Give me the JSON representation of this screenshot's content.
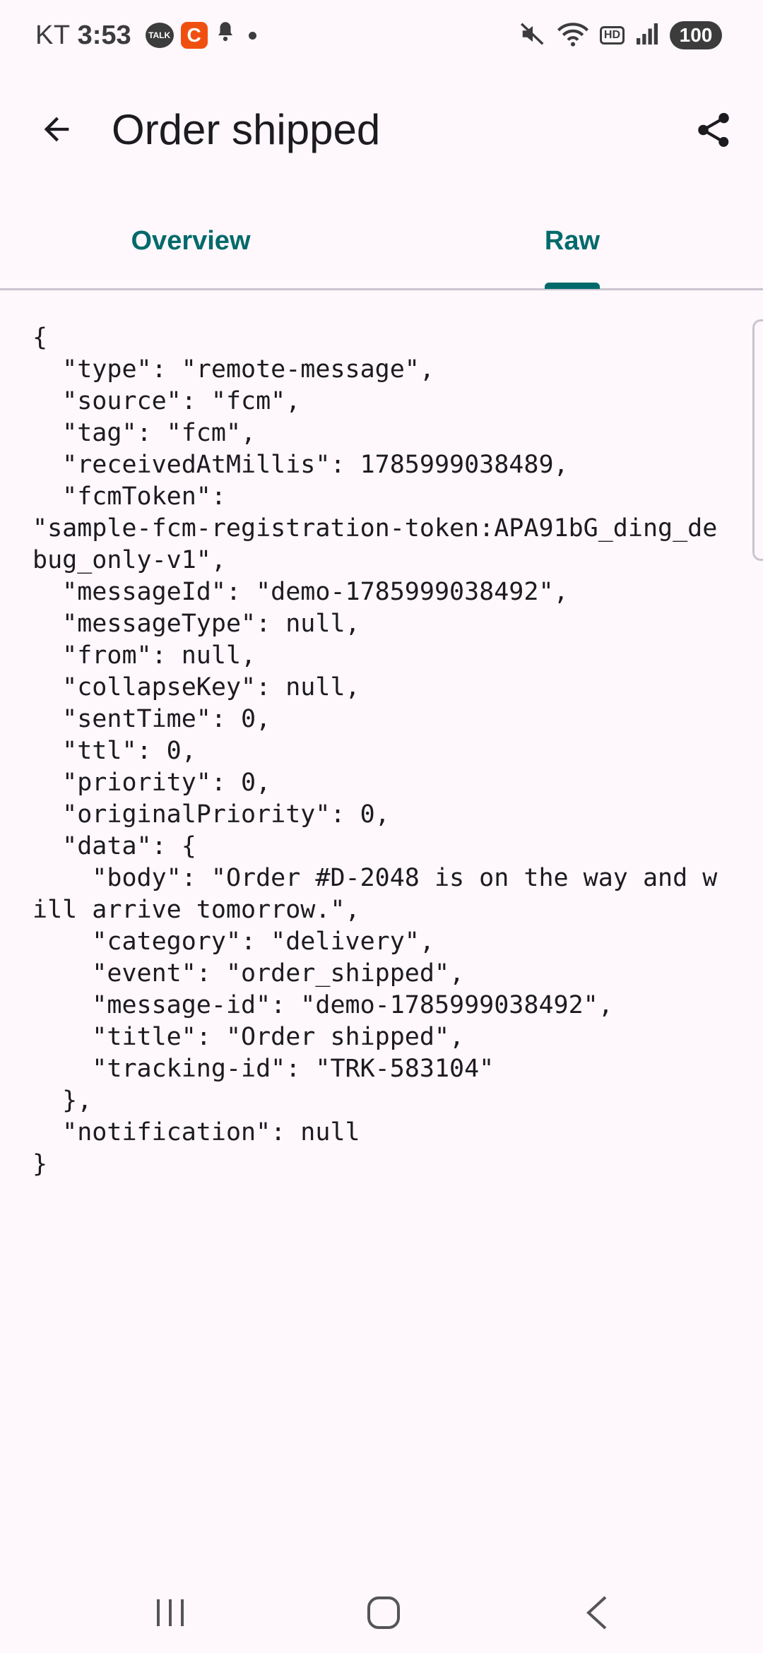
{
  "status_bar": {
    "carrier": "KT",
    "time": "3:53",
    "talk_icon_label": "TALK",
    "c_icon_label": "C",
    "battery": "100",
    "hd_label": "HD"
  },
  "app_bar": {
    "title": "Order shipped"
  },
  "tabs": [
    {
      "label": "Overview",
      "selected": false
    },
    {
      "label": "Raw",
      "selected": true
    }
  ],
  "raw_json": "{\n  \"type\": \"remote-message\",\n  \"source\": \"fcm\",\n  \"tag\": \"fcm\",\n  \"receivedAtMillis\": 1785999038489,\n  \"fcmToken\":\n\"sample-fcm-registration-token:APA91bG_ding_debug_only-v1\",\n  \"messageId\": \"demo-1785999038492\",\n  \"messageType\": null,\n  \"from\": null,\n  \"collapseKey\": null,\n  \"sentTime\": 0,\n  \"ttl\": 0,\n  \"priority\": 0,\n  \"originalPriority\": 0,\n  \"data\": {\n    \"body\": \"Order #D-2048 is on the way and will arrive tomorrow.\",\n    \"category\": \"delivery\",\n    \"event\": \"order_shipped\",\n    \"message-id\": \"demo-1785999038492\",\n    \"title\": \"Order shipped\",\n    \"tracking-id\": \"TRK-583104\"\n  },\n  \"notification\": null\n}",
  "colors": {
    "background": "#fef7fc",
    "accent": "#006a6a",
    "divider": "#cac4d0",
    "notification_c": "#f0500f"
  }
}
